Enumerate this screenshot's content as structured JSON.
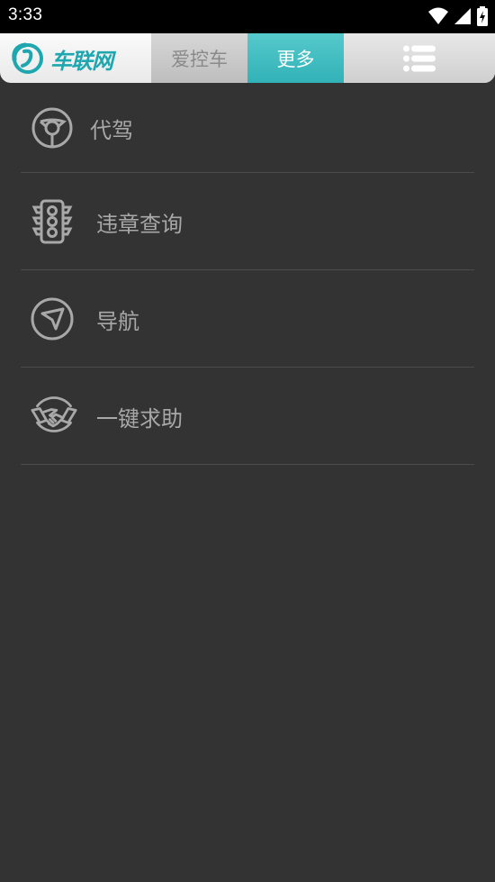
{
  "status": {
    "time": "3:33"
  },
  "header": {
    "logo_text": "车联网",
    "tabs": [
      {
        "label": "爱控车",
        "active": false
      },
      {
        "label": "更多",
        "active": true
      }
    ],
    "menu_icon": "list-menu-icon",
    "accent_color": "#31b2b7"
  },
  "menu": {
    "items": [
      {
        "label": "代驾",
        "icon": "steering-wheel-icon"
      },
      {
        "label": "违章查询",
        "icon": "traffic-light-icon"
      },
      {
        "label": "导航",
        "icon": "navigation-arrow-icon"
      },
      {
        "label": "一键求助",
        "icon": "handshake-icon"
      }
    ]
  }
}
